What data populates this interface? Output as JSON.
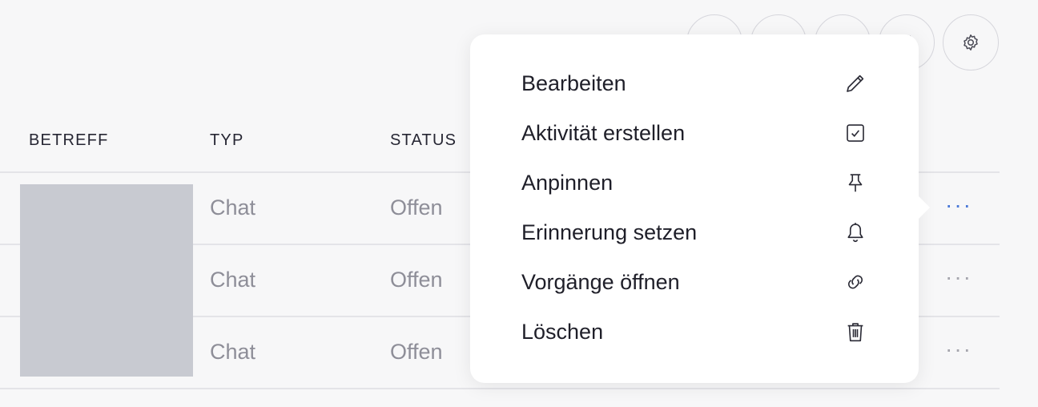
{
  "toolbar": {
    "buttons": [
      {
        "icon": "list-icon"
      },
      {
        "icon": "filter-icon"
      },
      {
        "icon": "search-icon"
      },
      {
        "icon": "sort-icon"
      },
      {
        "icon": "gear-icon"
      }
    ]
  },
  "table": {
    "columns": [
      "BETREFF",
      "TYP",
      "STATUS"
    ],
    "rows": [
      {
        "typ": "Chat",
        "status": "Offen",
        "more": "···"
      },
      {
        "typ": "Chat",
        "status": "Offen",
        "more": "···"
      },
      {
        "typ": "Chat",
        "status": "Offen",
        "more": "···"
      }
    ]
  },
  "menu": {
    "items": [
      {
        "label": "Bearbeiten",
        "icon": "pencil-icon"
      },
      {
        "label": "Aktivität erstellen",
        "icon": "checkbox-icon"
      },
      {
        "label": "Anpinnen",
        "icon": "pin-icon"
      },
      {
        "label": "Erinnerung setzen",
        "icon": "bell-icon"
      },
      {
        "label": "Vorgänge öffnen",
        "icon": "link-icon"
      },
      {
        "label": "Löschen",
        "icon": "trash-icon"
      }
    ]
  },
  "colors": {
    "accent": "#4a78d8",
    "muted_text": "#8e8e98",
    "redaction": "#c8cad1"
  }
}
